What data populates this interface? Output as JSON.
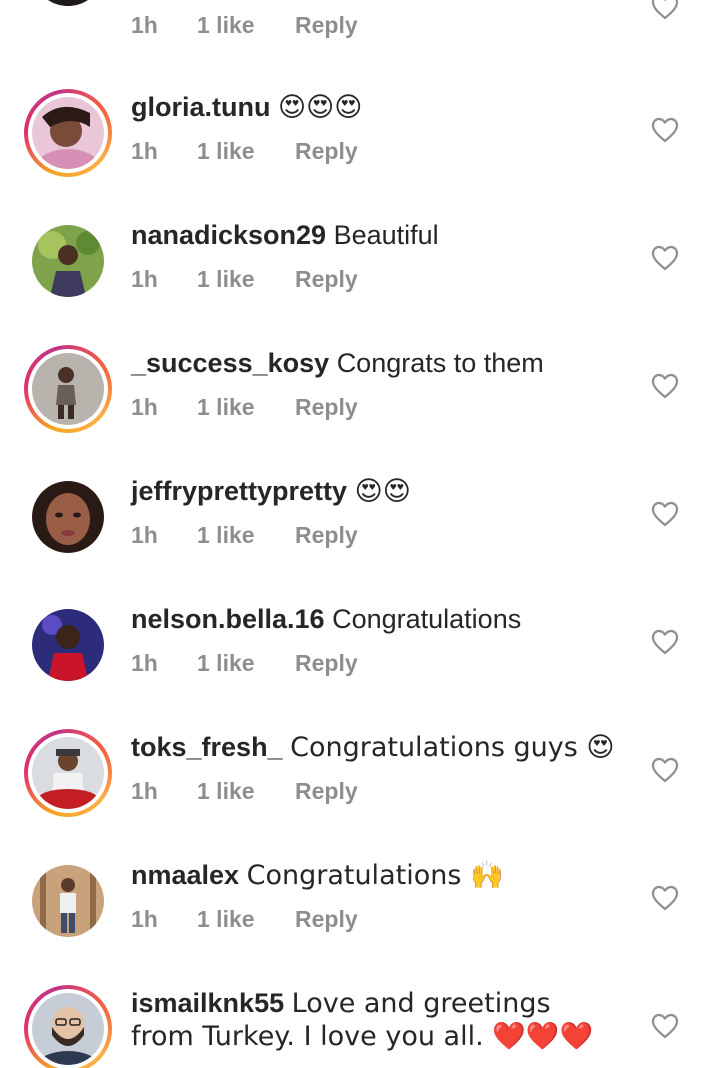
{
  "comments": [
    {
      "username": "",
      "text": "",
      "time": "1h",
      "likes": "1 like",
      "reply": "Reply",
      "story_ring": false,
      "avatar": "dark-selfie"
    },
    {
      "username": "gloria.tunu",
      "text": "😍😍😍",
      "time": "1h",
      "likes": "1 like",
      "reply": "Reply",
      "story_ring": true,
      "avatar": "pink-selfie"
    },
    {
      "username": "nanadickson29",
      "text": "Beautiful",
      "time": "1h",
      "likes": "1 like",
      "reply": "Reply",
      "story_ring": false,
      "avatar": "garden-portrait"
    },
    {
      "username": "_success_kosy",
      "text": "Congrats to them",
      "time": "1h",
      "likes": "1 like",
      "reply": "Reply",
      "story_ring": true,
      "avatar": "child-portrait"
    },
    {
      "username": "jeffryprettypretty",
      "text": "😍😍",
      "time": "1h",
      "likes": "1 like",
      "reply": "Reply",
      "story_ring": false,
      "avatar": "closeup-face"
    },
    {
      "username": "nelson.bella.16",
      "text": "Congratulations",
      "time": "1h",
      "likes": "1 like",
      "reply": "Reply",
      "story_ring": false,
      "avatar": "purple-portrait"
    },
    {
      "username": "toks_fresh_",
      "text": "Congratulations guys 😍",
      "time": "1h",
      "likes": "1 like",
      "reply": "Reply",
      "story_ring": true,
      "avatar": "red-car-portrait"
    },
    {
      "username": "nmaalex",
      "text": "Congratulations 🙌",
      "time": "1h",
      "likes": "1 like",
      "reply": "Reply",
      "story_ring": false,
      "avatar": "outdoor-portrait"
    },
    {
      "username": "ismailknk55",
      "text": "Love and greetings from Turkey. I love you all. ❤️❤️❤️",
      "time": "",
      "likes": "",
      "reply": "",
      "story_ring": true,
      "avatar": "bearded-man"
    }
  ],
  "icons": {
    "like": "heart-outline-icon"
  },
  "colors": {
    "username": "#262626",
    "meta": "#8e8e8e",
    "heart": "#8e8e8e"
  }
}
